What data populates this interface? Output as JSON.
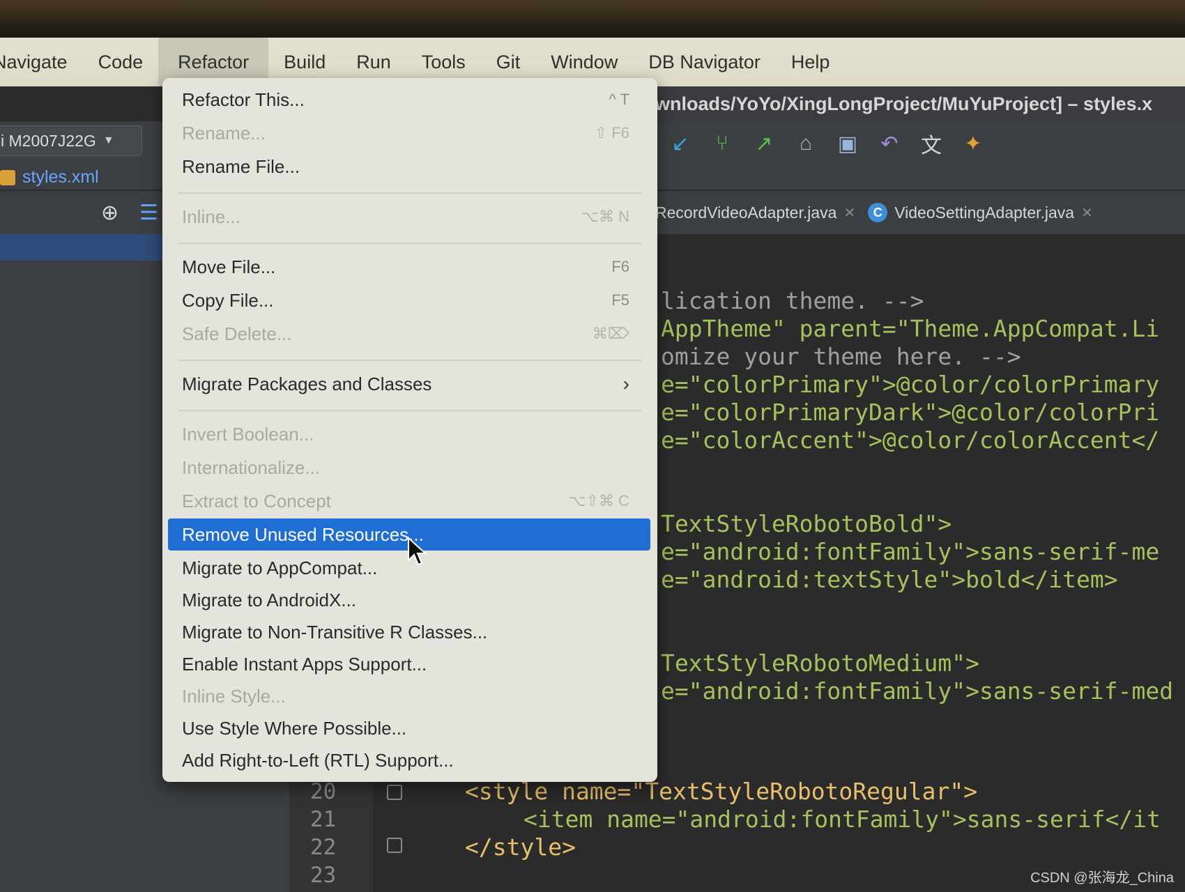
{
  "menubar": {
    "items": [
      "Navigate",
      "Code",
      "Refactor",
      "Build",
      "Run",
      "Tools",
      "Git",
      "Window",
      "DB Navigator",
      "Help"
    ],
    "active": "Refactor"
  },
  "window": {
    "title_fragment": "wnloads/YoYo/XingLongProject/MuYuProject] – styles.x"
  },
  "toolbar": {
    "device": "i M2007J22G",
    "file": "styles.xml"
  },
  "tabs": [
    {
      "label": "RecordVideoAdapter.java"
    },
    {
      "label": "VideoSettingAdapter.java",
      "icon_letter": "C"
    }
  ],
  "refactor_menu": {
    "items": [
      {
        "label": "Refactor This...",
        "shortcut": "^ T",
        "disabled": false
      },
      {
        "label": "Rename...",
        "shortcut": "⇧ F6",
        "disabled": true
      },
      {
        "label": "Rename File...",
        "shortcut": "",
        "disabled": false
      },
      {
        "label": "Inline...",
        "shortcut": "⌥⌘ N",
        "disabled": true
      },
      {
        "label": "Move File...",
        "shortcut": "F6",
        "disabled": false
      },
      {
        "label": "Copy File...",
        "shortcut": "F5",
        "disabled": false
      },
      {
        "label": "Safe Delete...",
        "shortcut": "⌘⌦",
        "disabled": true
      },
      {
        "label": "Migrate Packages and Classes",
        "shortcut": "›",
        "disabled": false
      },
      {
        "label": "Invert Boolean...",
        "shortcut": "",
        "disabled": true
      },
      {
        "label": "Internationalize...",
        "shortcut": "",
        "disabled": true
      },
      {
        "label": "Extract to Concept",
        "shortcut": "⌥⇧⌘ C",
        "disabled": true
      },
      {
        "label": "Remove Unused Resources...",
        "shortcut": "",
        "disabled": false,
        "highlighted": true
      },
      {
        "label": "Migrate to AppCompat...",
        "shortcut": "",
        "disabled": false
      },
      {
        "label": "Migrate to AndroidX...",
        "shortcut": "",
        "disabled": false
      },
      {
        "label": "Migrate to Non-Transitive R Classes...",
        "shortcut": "",
        "disabled": false
      },
      {
        "label": "Enable Instant Apps Support...",
        "shortcut": "",
        "disabled": false
      },
      {
        "label": "Inline Style...",
        "shortcut": "",
        "disabled": true
      },
      {
        "label": "Use Style Where Possible...",
        "shortcut": "",
        "disabled": false
      },
      {
        "label": "Add Right-to-Left (RTL) Support...",
        "shortcut": "",
        "disabled": false
      }
    ]
  },
  "code_lines": [
    "lication theme. -->",
    "AppTheme\" parent=\"Theme.AppCompat.Li",
    "omize your theme here. -->",
    "e=\"colorPrimary\">@color/colorPrimary",
    "e=\"colorPrimaryDark\">@color/colorPri",
    "e=\"colorAccent\">@color/colorAccent</",
    "TextStyleRobotoBold\">",
    "e=\"android:fontFamily\">sans-serif-me",
    "e=\"android:textStyle\">bold</item>",
    "TextStyleRobotoMedium\">",
    "e=\"android:fontFamily\">sans-serif-med",
    "<style name=\"TextStyleRobotoRegular\">",
    "<item name=\"android:fontFamily\">sans-serif</it",
    "</style>"
  ],
  "line_numbers": [
    "20",
    "21",
    "22",
    "23"
  ],
  "watermark": "CSDN @张海龙_China"
}
